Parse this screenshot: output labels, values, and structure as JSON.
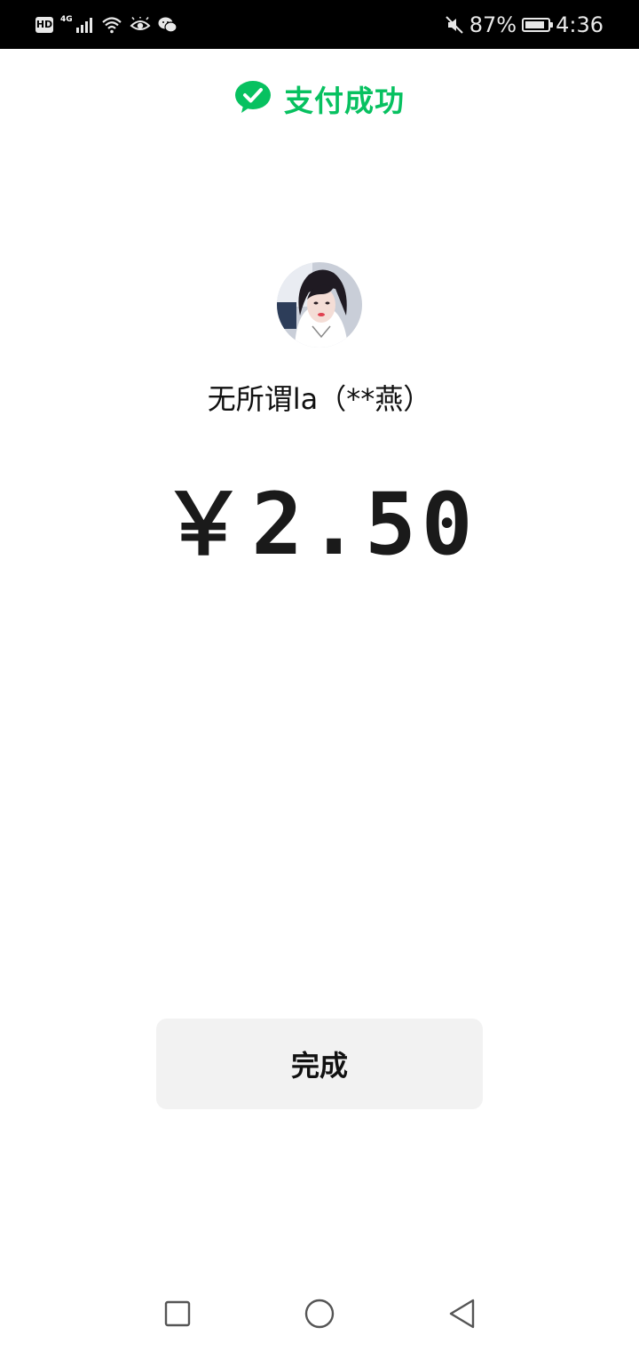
{
  "status_bar": {
    "hd": "HD",
    "network": "4G",
    "battery_text": "87%",
    "battery_level": 0.87,
    "time": "4:36"
  },
  "header": {
    "title": "支付成功",
    "accent_color": "#07C160"
  },
  "payee": {
    "name": "无所谓la（**燕）"
  },
  "amount": {
    "text": "￥2.50"
  },
  "actions": {
    "done_label": "完成"
  },
  "nav": {
    "items": [
      "recents-icon",
      "home-icon",
      "back-icon"
    ]
  }
}
